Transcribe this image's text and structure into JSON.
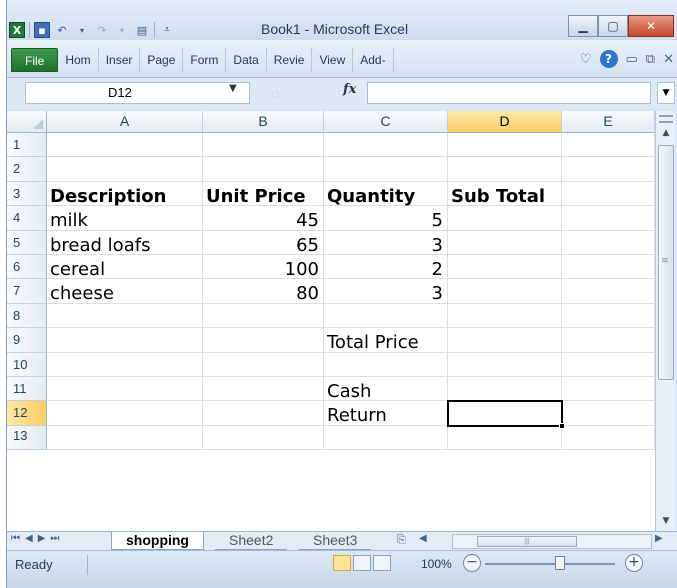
{
  "app": {
    "title": "Book1 - Microsoft Excel",
    "qat_icons": [
      "excel-icon",
      "save-icon",
      "undo-icon",
      "redo-icon",
      "customize-icon"
    ],
    "window_buttons": [
      "minimize",
      "restore",
      "close"
    ]
  },
  "ribbon": {
    "tabs": [
      "File",
      "Hom",
      "Inser",
      "Page",
      "Form",
      "Data",
      "Revie",
      "View",
      "Add-"
    ]
  },
  "formula_bar": {
    "name_box": "D12",
    "fx_label": "fx",
    "formula": ""
  },
  "grid": {
    "columns": [
      "A",
      "B",
      "C",
      "D",
      "E"
    ],
    "selected_column": "D",
    "rows": [
      "1",
      "2",
      "3",
      "4",
      "5",
      "6",
      "7",
      "8",
      "9",
      "10",
      "11",
      "12",
      "13"
    ],
    "selected_row": "12",
    "cells": {
      "A3": "Description",
      "B3": "Unit Price",
      "C3": "Quantity",
      "D3": "Sub Total",
      "A4": "milk",
      "B4": "45",
      "C4": "5",
      "A5": "bread loafs",
      "B5": "65",
      "C5": "3",
      "A6": "cereal",
      "B6": "100",
      "C6": "2",
      "A7": "cheese",
      "B7": "80",
      "C7": "3",
      "C9": "Total Price",
      "C11": "Cash",
      "C12": "Return"
    },
    "active_cell": "D12"
  },
  "sheets": {
    "tabs": [
      "shopping",
      "Sheet2",
      "Sheet3"
    ],
    "active": "shopping"
  },
  "status": {
    "text": "Ready",
    "zoom": "100%"
  }
}
